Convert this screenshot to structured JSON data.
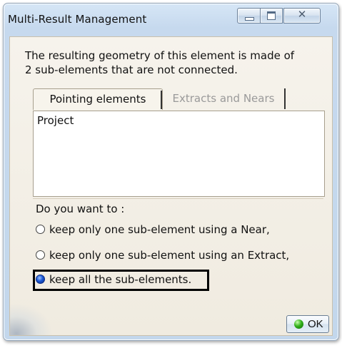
{
  "window": {
    "title": "Multi-Result Management",
    "close_symbol": "✕"
  },
  "message": {
    "line1": "The resulting geometry of this element is made of",
    "line2": "2 sub-elements that are not connected."
  },
  "tabs": [
    {
      "label": "Pointing elements",
      "active": true
    },
    {
      "label": "Extracts and Nears",
      "active": false
    }
  ],
  "list": {
    "items": [
      "Project"
    ]
  },
  "options": {
    "title": "Do you want to :",
    "choices": [
      {
        "label": "keep  only  one  sub-element using a Near,",
        "selected": false
      },
      {
        "label": "keep  only  one  sub-element using an Extract,",
        "selected": false
      },
      {
        "label": "keep all the sub-elements.",
        "selected": true
      }
    ]
  },
  "buttons": {
    "ok_label": "OK"
  },
  "icons": {
    "ok": "green-circle-icon",
    "minimize": "minimize-icon",
    "maximize": "maximize-icon",
    "close": "close-icon"
  },
  "colors": {
    "title_bar": "#c6d9ee",
    "dialog_background": "#f0ebe0",
    "highlight_border": "#000000",
    "ok_icon": "#33b11b"
  }
}
